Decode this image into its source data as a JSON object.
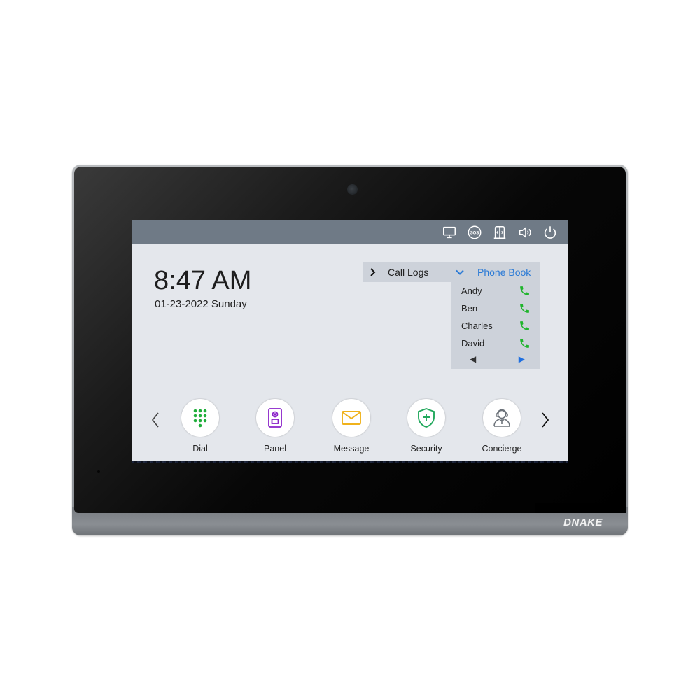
{
  "device": {
    "brand": "DNAKE"
  },
  "statusbar": {
    "icons": [
      {
        "name": "monitor-icon"
      },
      {
        "name": "sos-icon",
        "label": "SOS"
      },
      {
        "name": "elevator-icon"
      },
      {
        "name": "volume-icon"
      },
      {
        "name": "power-icon"
      }
    ]
  },
  "home": {
    "time": "8:47 AM",
    "date": "01-23-2022 Sunday"
  },
  "tabs": {
    "call_logs": "Call Logs",
    "phone_book": "Phone Book"
  },
  "phone_book": {
    "contacts": [
      {
        "name": "Andy"
      },
      {
        "name": "Ben"
      },
      {
        "name": "Charles"
      },
      {
        "name": "David"
      }
    ],
    "pager": {
      "prev": "◀",
      "next": "▶"
    }
  },
  "apps": [
    {
      "label": "Dial",
      "icon": "dialpad-icon",
      "color": "#1fae3a"
    },
    {
      "label": "Panel",
      "icon": "door-panel-icon",
      "color": "#8a22c9"
    },
    {
      "label": "Message",
      "icon": "envelope-icon",
      "color": "#f0b21c"
    },
    {
      "label": "Security",
      "icon": "shield-plus-icon",
      "color": "#21a85c"
    },
    {
      "label": "Concierge",
      "icon": "concierge-icon",
      "color": "#6d737a"
    }
  ],
  "colors": {
    "accent_blue": "#2a7ad6",
    "call_green": "#1fb52c",
    "statusbar": "#6f7a86",
    "screen_bg": "#e4e7ec",
    "panel_bg": "#cdd2da"
  }
}
